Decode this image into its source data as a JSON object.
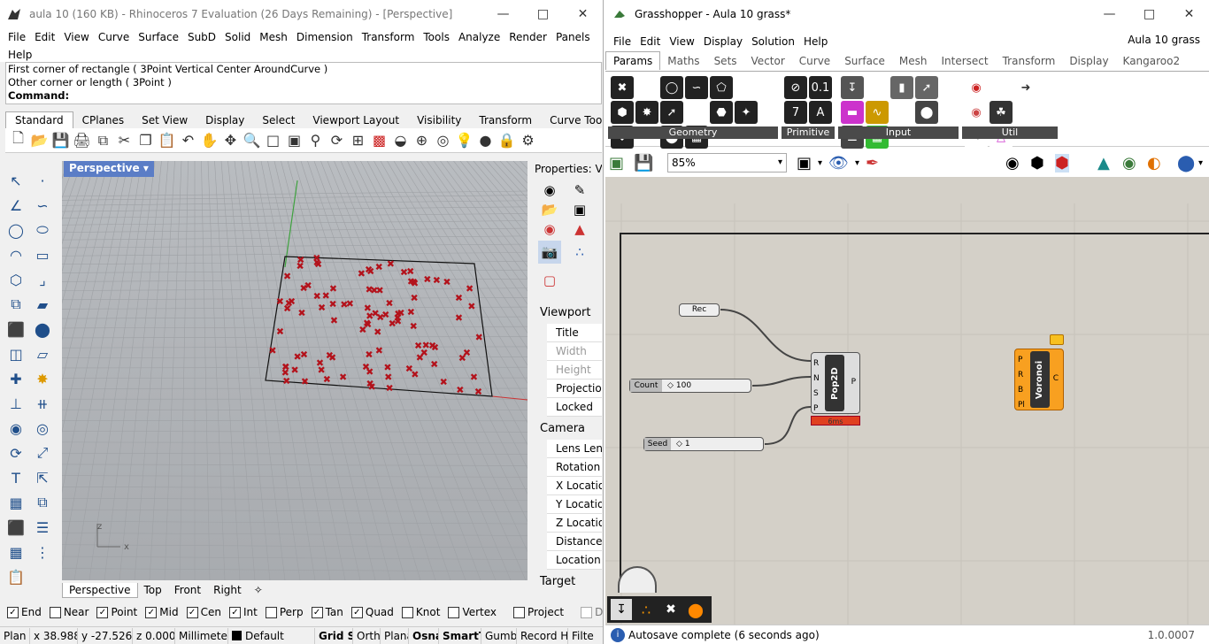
{
  "rhino": {
    "title": "aula 10 (160 KB) - Rhinoceros 7 Evaluation (26 Days Remaining) - [Perspective]",
    "menu": [
      "File",
      "Edit",
      "View",
      "Curve",
      "Surface",
      "SubD",
      "Solid",
      "Mesh",
      "Dimension",
      "Transform",
      "Tools",
      "Analyze",
      "Render",
      "Panels",
      "Help"
    ],
    "history": [
      "First corner of rectangle ( 3Point  Vertical  Center  AroundCurve )",
      "Other corner or length ( 3Point )"
    ],
    "command_label": "Command:",
    "toolbar_tabs": [
      "Standard",
      "CPlanes",
      "Set View",
      "Display",
      "Select",
      "Viewport Layout",
      "Visibility",
      "Transform",
      "Curve Tools"
    ],
    "viewport_name": "Perspective",
    "viewport_tabs": [
      "Perspective",
      "Top",
      "Front",
      "Right"
    ],
    "axis_labels": {
      "z": "z",
      "x": "x"
    },
    "properties": {
      "header": "Properties: V...",
      "section_viewport": "Viewport",
      "viewport_fields": [
        "Title",
        "Width",
        "Height",
        "Projection",
        "Locked"
      ],
      "section_camera": "Camera",
      "camera_fields": [
        "Lens Length",
        "Rotation",
        "X Location",
        "Y Location",
        "Z Location",
        "Distance",
        "Location"
      ],
      "section_target": "Target"
    },
    "osnaps": [
      {
        "label": "End",
        "checked": true
      },
      {
        "label": "Near",
        "checked": false
      },
      {
        "label": "Point",
        "checked": true
      },
      {
        "label": "Mid",
        "checked": true
      },
      {
        "label": "Cen",
        "checked": true
      },
      {
        "label": "Int",
        "checked": true
      },
      {
        "label": "Perp",
        "checked": false
      },
      {
        "label": "Tan",
        "checked": true
      },
      {
        "label": "Quad",
        "checked": true
      },
      {
        "label": "Knot",
        "checked": false
      },
      {
        "label": "Vertex",
        "checked": false
      },
      {
        "label": "Project",
        "checked": false
      },
      {
        "label": "Disable",
        "checked": false
      }
    ],
    "status": {
      "cplane": "Plan",
      "x": "x 38.988",
      "y": "y -27.526",
      "z": "z 0.000",
      "units": "Millimeter",
      "layer": "Default",
      "grid_snap": "Grid Sn",
      "ortho": "Ortho",
      "planar": "Plana",
      "osnap": "Osnap",
      "smarttrack": "SmartTr",
      "gumball": "Gumba",
      "record": "Record His",
      "filter": "Filte"
    }
  },
  "gh": {
    "title": "Grasshopper - Aula 10 grass*",
    "menu": [
      "File",
      "Edit",
      "View",
      "Display",
      "Solution",
      "Help"
    ],
    "doc_name": "Aula 10 grass",
    "tabs": [
      "Params",
      "Maths",
      "Sets",
      "Vector",
      "Curve",
      "Surface",
      "Mesh",
      "Intersect",
      "Transform",
      "Display",
      "Kangaroo2"
    ],
    "ribbon_groups": [
      "Geometry",
      "Primitive",
      "Input",
      "Util"
    ],
    "zoom": "85%",
    "nodes": {
      "rec": "Rec",
      "count_label": "Count",
      "count_value": "100",
      "seed_label": "Seed",
      "seed_value": "1",
      "pop_name": "Pop2D",
      "pop_inputs": [
        "R",
        "N",
        "S",
        "P"
      ],
      "pop_output": "P",
      "pop_time": "6ms",
      "vor_name": "Voronoi",
      "vor_inputs": [
        "P",
        "R",
        "B",
        "Pl"
      ],
      "vor_output": "C"
    },
    "status": "Autosave complete (6 seconds ago)",
    "version": "1.0.0007"
  }
}
